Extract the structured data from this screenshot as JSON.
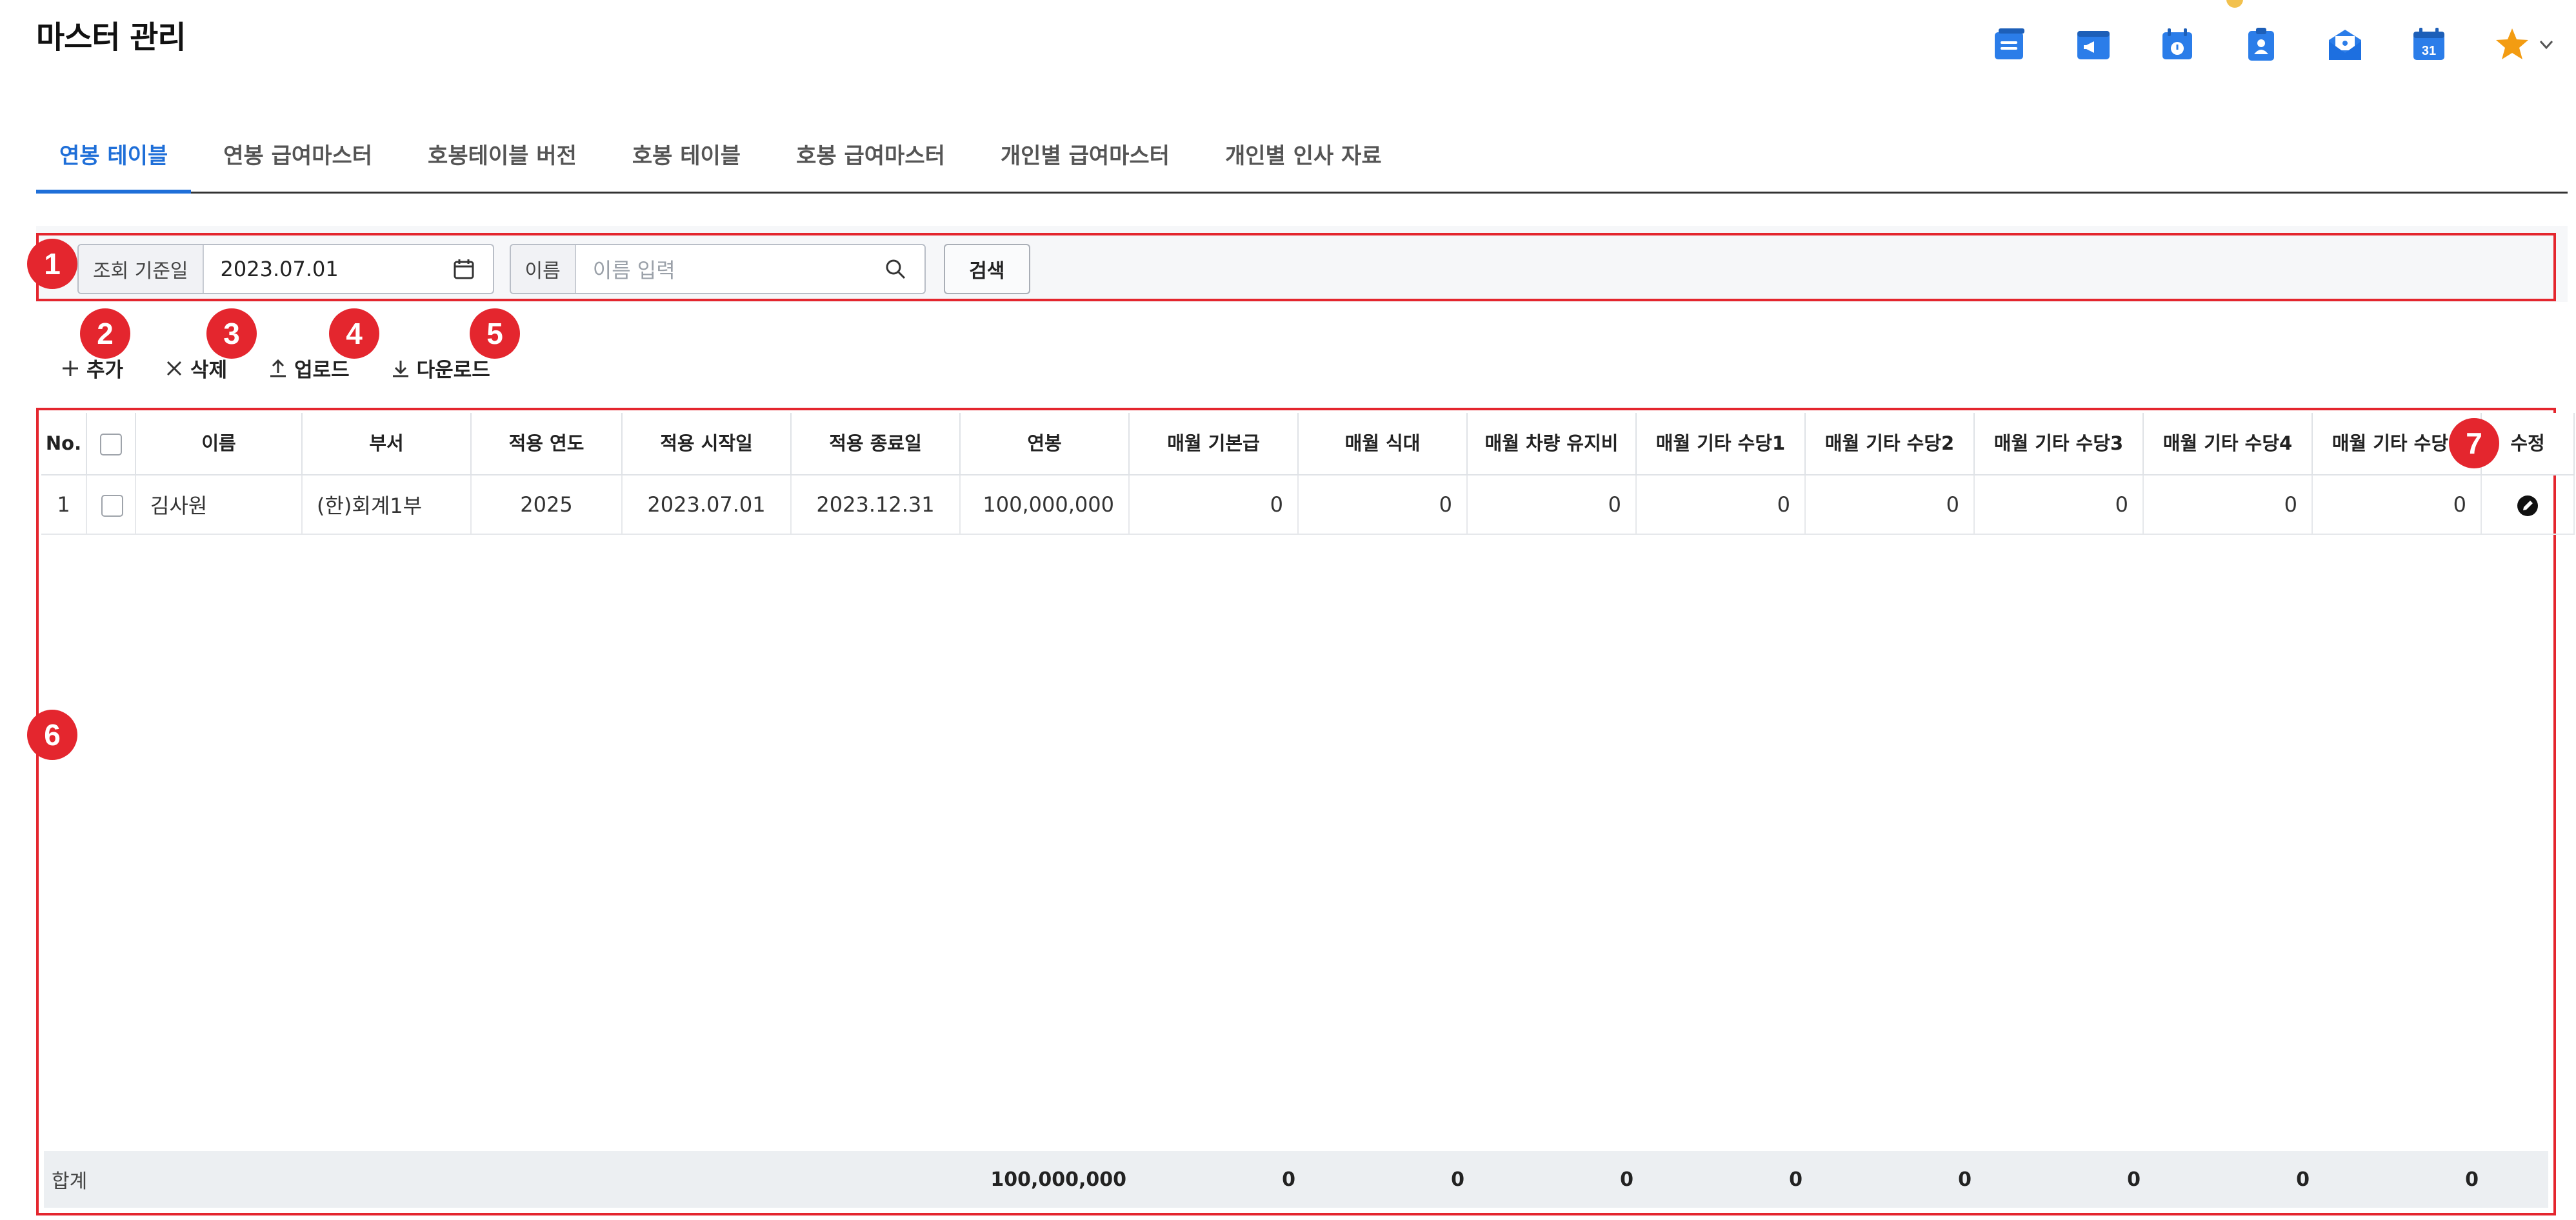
{
  "page": {
    "title": "마스터 관리"
  },
  "top_icons": [
    {
      "name": "board-icon",
      "color": "#2b7de9"
    },
    {
      "name": "notice-icon",
      "color": "#2b7de9"
    },
    {
      "name": "schedule-icon",
      "color": "#2b7de9"
    },
    {
      "name": "contact-icon",
      "color": "#2b7de9"
    },
    {
      "name": "mail-icon",
      "color": "#2b7de9"
    },
    {
      "name": "calendar-icon",
      "color": "#2b7de9",
      "text": "31"
    },
    {
      "name": "favorite-star-icon",
      "color": "#f39c12"
    }
  ],
  "tabs": [
    {
      "label": "연봉 테이블",
      "active": true
    },
    {
      "label": "연봉 급여마스터",
      "active": false
    },
    {
      "label": "호봉테이블 버전",
      "active": false
    },
    {
      "label": "호봉 테이블",
      "active": false
    },
    {
      "label": "호봉 급여마스터",
      "active": false
    },
    {
      "label": "개인별 급여마스터",
      "active": false
    },
    {
      "label": "개인별 인사 자료",
      "active": false
    }
  ],
  "filter": {
    "date_label": "조회 기준일",
    "date_value": "2023.07.01",
    "name_label": "이름",
    "name_placeholder": "이름 입력",
    "search_label": "검색"
  },
  "toolbar": {
    "add_label": "추가",
    "delete_label": "삭제",
    "upload_label": "업로드",
    "download_label": "다운로드"
  },
  "badges": [
    "1",
    "2",
    "3",
    "4",
    "5",
    "6",
    "7"
  ],
  "grid": {
    "columns": [
      "No.",
      "",
      "이름",
      "부서",
      "적용 연도",
      "적용 시작일",
      "적용 종료일",
      "연봉",
      "매월 기본급",
      "매월 식대",
      "매월 차량 유지비",
      "매월 기타 수당1",
      "매월 기타 수당2",
      "매월 기타 수당3",
      "매월 기타 수당4",
      "매월 기타 수당5",
      "수정"
    ],
    "rows": [
      [
        "1",
        "",
        "김사원",
        "(한)회계1부",
        "2025",
        "2023.07.01",
        "2023.12.31",
        "100,000,000",
        "0",
        "0",
        "0",
        "0",
        "0",
        "0",
        "0",
        "0",
        ""
      ]
    ],
    "summary": {
      "label": "합계",
      "values": [
        "100,000,000",
        "0",
        "0",
        "0",
        "0",
        "0",
        "0",
        "0",
        "0"
      ]
    }
  },
  "colors": {
    "accent": "#1f6fd8",
    "annotation": "#e4262e"
  }
}
